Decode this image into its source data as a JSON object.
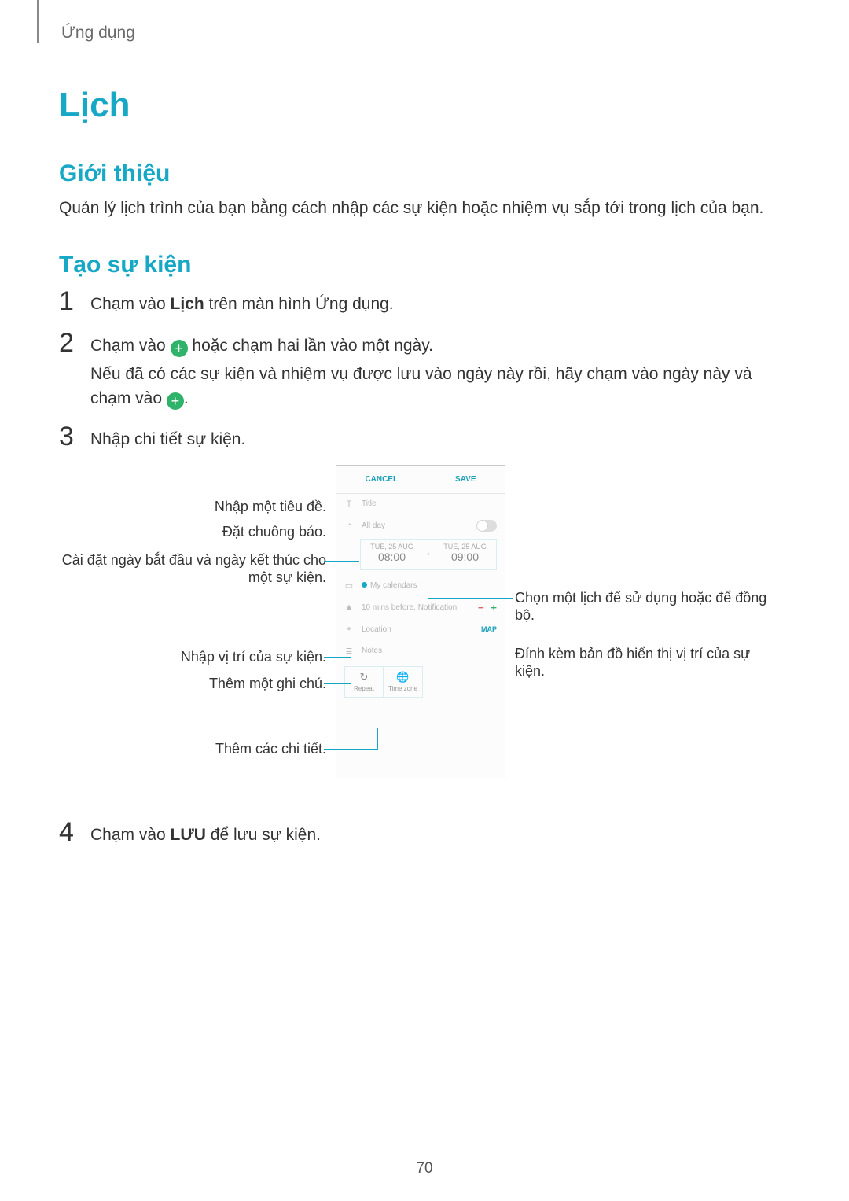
{
  "breadcrumb": "Ứng dụng",
  "title": "Lịch",
  "section_intro": "Giới thiệu",
  "intro_body": "Quản lý lịch trình của bạn bằng cách nhập các sự kiện hoặc nhiệm vụ sắp tới trong lịch của bạn.",
  "section_create": "Tạo sự kiện",
  "steps": {
    "n1": "1",
    "s1_a": "Chạm vào ",
    "s1_b": "Lịch",
    "s1_c": " trên màn hình Ứng dụng.",
    "n2": "2",
    "s2_a": "Chạm vào ",
    "s2_b": " hoặc chạm hai lần vào một ngày.",
    "s2_sub_a": "Nếu đã có các sự kiện và nhiệm vụ được lưu vào ngày này rồi, hãy chạm vào ngày này và chạm vào ",
    "s2_sub_b": ".",
    "n3": "3",
    "s3": "Nhập chi tiết sự kiện.",
    "n4": "4",
    "s4_a": "Chạm vào ",
    "s4_b": "LƯU",
    "s4_c": " để lưu sự kiện."
  },
  "phone": {
    "cancel": "CANCEL",
    "save": "SAVE",
    "title_ph": "Title",
    "allday": "All day",
    "date_label": "TUE, 25 AUG",
    "time_start": "08:00",
    "time_end": "09:00",
    "mycal": "My calendars",
    "reminder": "10 mins before, Notification",
    "location": "Location",
    "map": "MAP",
    "notes": "Notes",
    "repeat": "Repeat",
    "timezone": "Time zone"
  },
  "callouts": {
    "c_title": "Nhập một tiêu đề.",
    "c_alarm": "Đặt chuông báo.",
    "c_dates": "Cài đặt ngày bắt đầu và ngày kết thúc cho một sự kiện.",
    "c_location": "Nhập vị trí của sự kiện.",
    "c_note": "Thêm một ghi chú.",
    "c_detail": "Thêm các chi tiết.",
    "c_calendar": "Chọn một lịch để sử dụng hoặc để đồng bộ.",
    "c_map": "Đính kèm bản đồ hiển thị vị trí của sự kiện."
  },
  "page_number": "70"
}
